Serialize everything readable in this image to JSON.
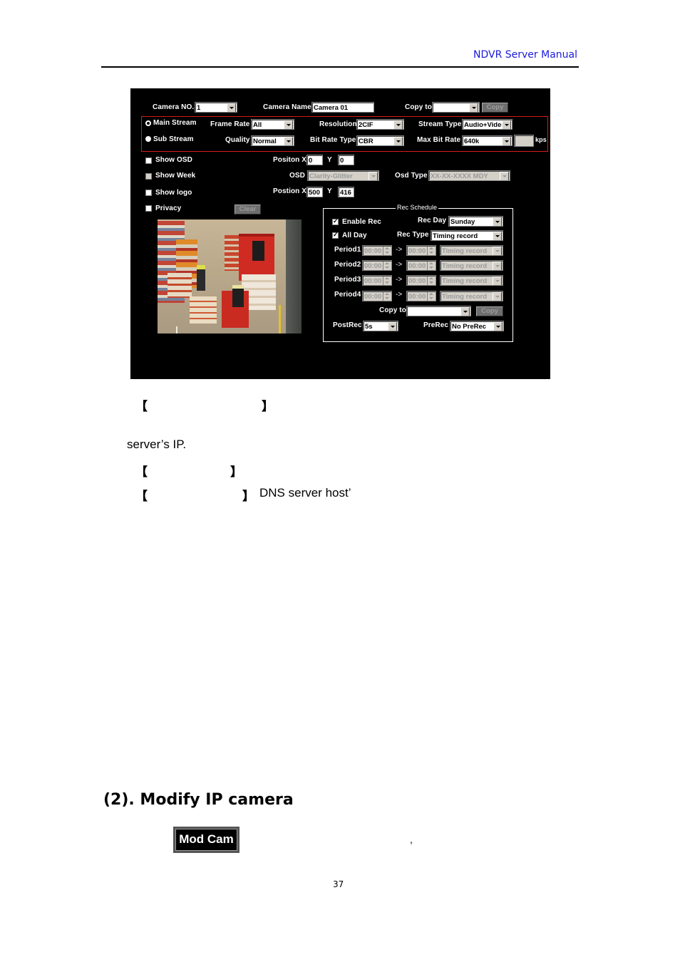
{
  "header": {
    "title": "NDVR Server Manual",
    "title_color": "#1a1adb"
  },
  "dialog": {
    "camera_no_label": "Camera NO.",
    "camera_no_value": "1",
    "camera_name_label": "Camera Name",
    "camera_name_value": "Camera 01",
    "copy_to_label": "Copy to",
    "copy_to_value": "",
    "copy_button": "Copy",
    "streams": {
      "main_stream": "Main Stream",
      "sub_stream": "Sub Stream",
      "selected": "Main Stream",
      "frame_rate_label": "Frame Rate",
      "frame_rate_value": "All",
      "quality_label": "Quality",
      "quality_value": "Normal",
      "resolution_label": "Resolution",
      "resolution_value": "2CIF",
      "bit_rate_type_label": "Bit Rate Type",
      "bit_rate_type_value": "CBR",
      "stream_type_label": "Stream Type",
      "stream_type_value": "Audio+Video",
      "max_bit_rate_label": "Max Bit Rate",
      "max_bit_rate_value": "640k",
      "custom_rate_value": "",
      "kps_label": "kps"
    },
    "osd": {
      "show_osd": "Show OSD",
      "show_week": "Show Week",
      "show_logo": "Show logo",
      "privacy": "Privacy",
      "clear_button": "Clear",
      "osd_pos_x_label": "Positon X",
      "osd_pos_x": "0",
      "osd_y_label": "Y",
      "osd_pos_y": "0",
      "osd_label": "OSD",
      "osd_value": "Clarity-Glitter",
      "osd_type_label": "Osd Type",
      "osd_type_value": "XX-XX-XXXX MDY",
      "logo_pos_x_label": "Postion X",
      "logo_pos_x": "500",
      "logo_y_label": "Y",
      "logo_pos_y": "416"
    },
    "schedule": {
      "title": "Rec Schedule",
      "enable_rec": "Enable Rec",
      "all_day": "All Day",
      "rec_day_label": "Rec Day",
      "rec_day_value": "Sunday",
      "rec_type_label": "Rec Type",
      "rec_type_value": "Timing record",
      "arrow": "->",
      "periods": [
        {
          "label": "Period1",
          "start": "00:00",
          "end": "00:00",
          "type": "Timing record"
        },
        {
          "label": "Period2",
          "start": "00:00",
          "end": "00:00",
          "type": "Timing record"
        },
        {
          "label": "Period3",
          "start": "00:00",
          "end": "00:00",
          "type": "Timing record"
        },
        {
          "label": "Period4",
          "start": "00:00",
          "end": "00:00",
          "type": "Timing record"
        }
      ],
      "copy_to_label": "Copy to",
      "copy_to_value": "",
      "copy_button": "Copy",
      "postrec_label": "PostRec",
      "postrec_value": "5s",
      "prerec_label": "PreRec",
      "prerec_value": "No PreRec"
    },
    "accent_red": "#d81b1b"
  },
  "body": {
    "bracket_line1_open": "【",
    "bracket_line1_close": "】",
    "server_ip_text": "server’s IP.",
    "bracket_line2_open": "【",
    "bracket_line2_close": "】",
    "bracket_line3_open": "【",
    "bracket_line3_close": "】",
    "dns_text": "DNS server host’",
    "section_title": "(2). Modify IP camera",
    "mod_cam_button": "Mod Cam",
    "comma": ",",
    "page_number": "37"
  }
}
